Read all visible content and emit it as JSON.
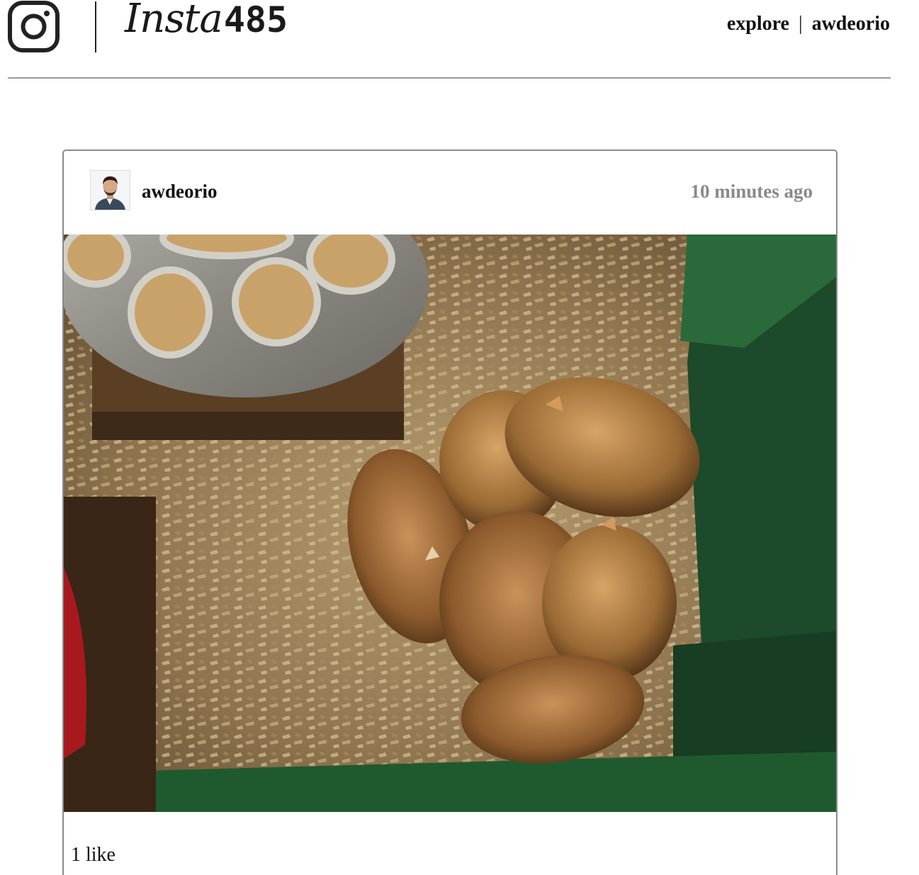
{
  "header": {
    "logo_icon": "instagram-camera-icon",
    "brand_script": "Insta",
    "brand_number": "485",
    "nav": {
      "explore_label": "explore",
      "separator": "|",
      "user_label": "awdeorio"
    }
  },
  "post": {
    "owner": "awdeorio",
    "timestamp": "10 minutes ago",
    "avatar_icon": "user-avatar",
    "image_alt": "",
    "likes_text": "1 like"
  },
  "colors": {
    "text": "#111111",
    "muted": "#8a8a8a",
    "rule": "#9a9a9a",
    "card_border": "#8a8a8a"
  }
}
